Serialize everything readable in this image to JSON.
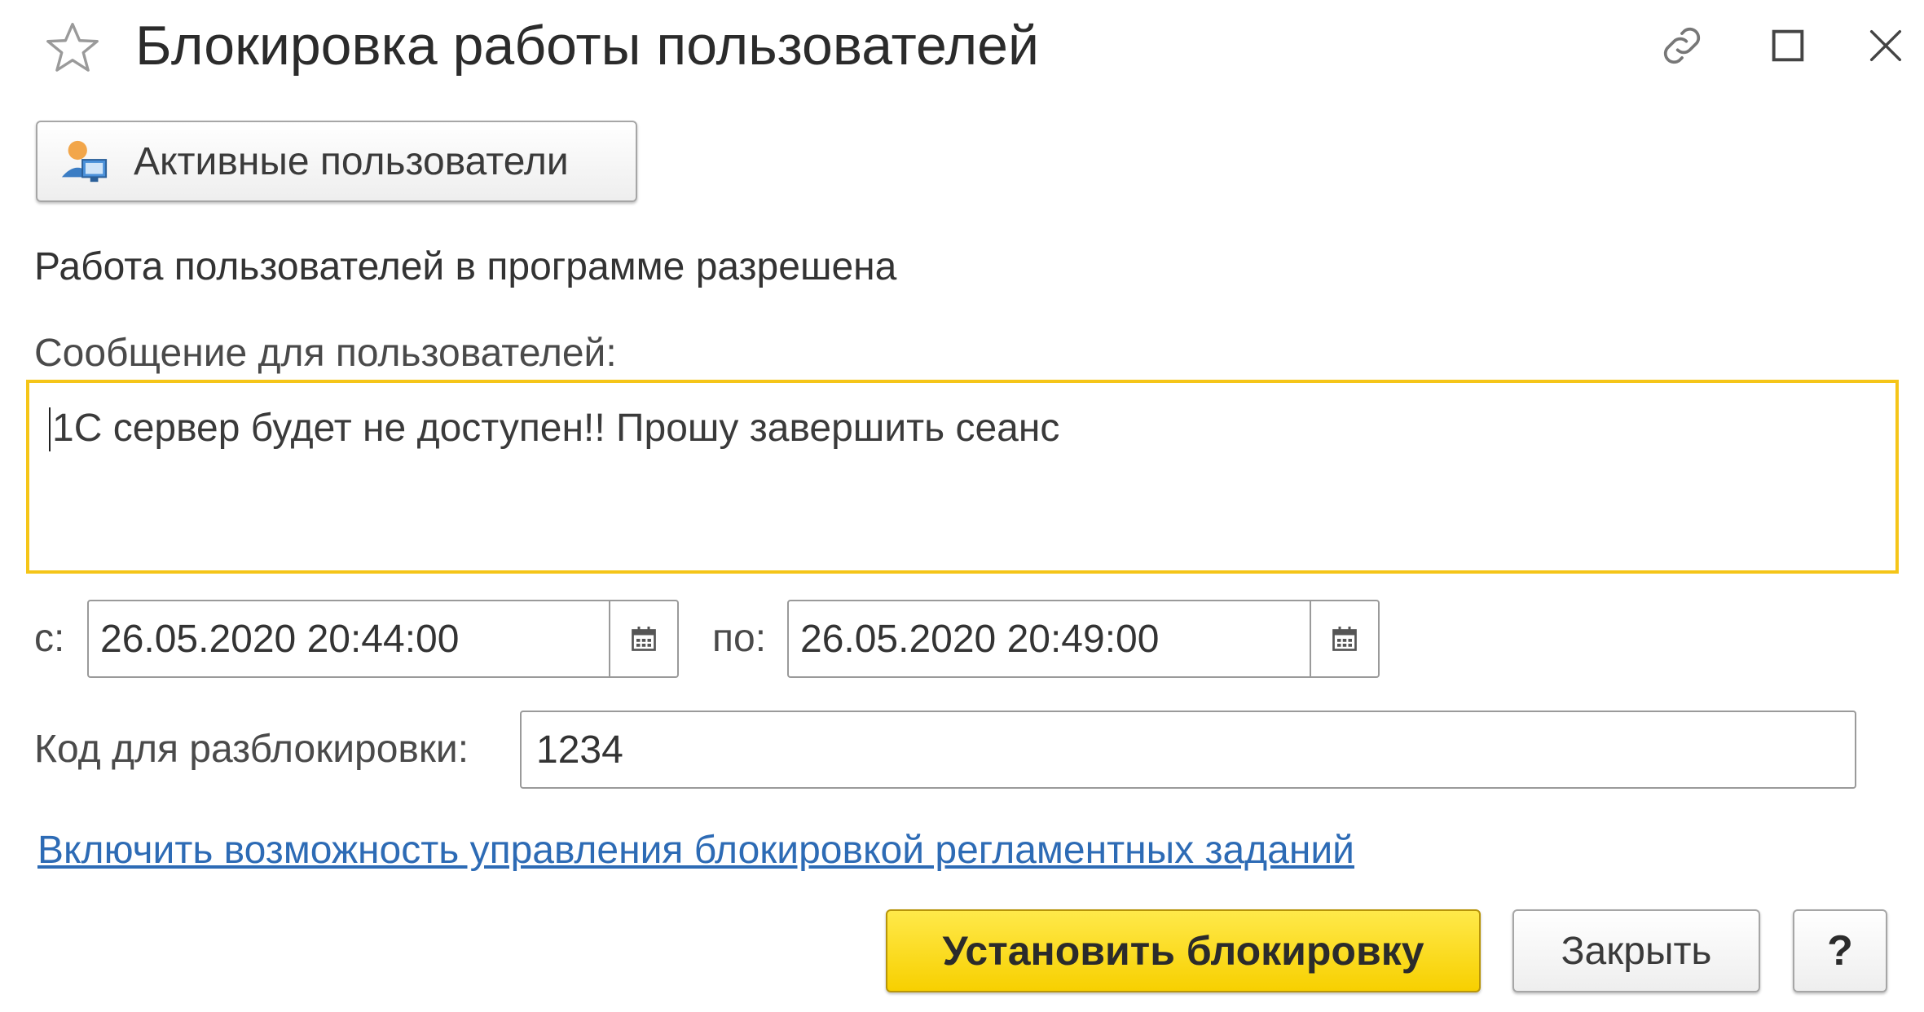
{
  "window": {
    "title": "Блокировка работы пользователей",
    "icons": [
      "star-icon",
      "link-icon",
      "maximize-icon",
      "close-icon"
    ]
  },
  "toolbar": {
    "active_users_label": "Активные пользователи",
    "active_users_icon": "users-icon"
  },
  "status": {
    "text": "Работа пользователей в программе разрешена"
  },
  "message": {
    "label": "Сообщение для пользователей:",
    "value": "1С сервер будет не доступен!! Прошу завершить сеанс"
  },
  "period": {
    "from_label": "с:",
    "from_value": "26.05.2020 20:44:00",
    "to_label": "по:",
    "to_value": "26.05.2020 20:49:00",
    "calendar_icon": "calendar-icon"
  },
  "unlock": {
    "label": "Код для разблокировки:",
    "value": "1234"
  },
  "jobs_link": {
    "text": "Включить возможность управления блокировкой регламентных заданий"
  },
  "buttons": {
    "set_lock": "Установить блокировку",
    "close": "Закрыть",
    "help": "?"
  },
  "colors": {
    "accent_yellow": "#f7d000",
    "focus_border": "#f5c518",
    "link": "#2d6bb5"
  }
}
